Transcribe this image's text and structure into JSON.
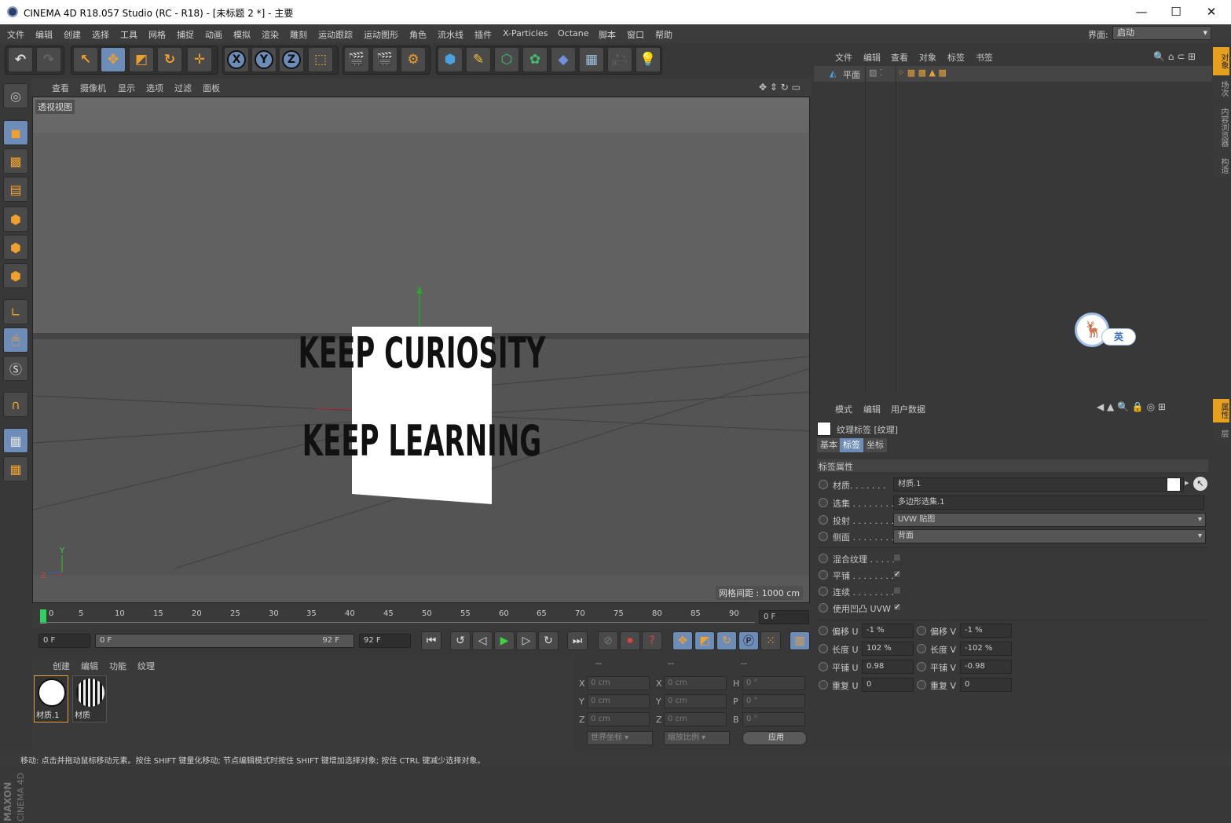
{
  "window": {
    "title": "CINEMA 4D R18.057 Studio (RC - R18) - [未标题 2 *] - 主要",
    "controls": [
      "—",
      "☐",
      "✕"
    ]
  },
  "menubar": {
    "items": [
      "文件",
      "编辑",
      "创建",
      "选择",
      "工具",
      "网格",
      "捕捉",
      "动画",
      "模拟",
      "渲染",
      "雕刻",
      "运动跟踪",
      "运动图形",
      "角色",
      "流水线",
      "插件",
      "X-Particles",
      "Octane",
      "脚本",
      "窗口",
      "帮助"
    ],
    "layout_label": "界面:",
    "layout_value": "启动"
  },
  "toolbar": {
    "axis_x": "X",
    "axis_y": "Y",
    "axis_z": "Z"
  },
  "viewport": {
    "menu": [
      "查看",
      "摄像机",
      "显示",
      "选项",
      "过滤",
      "面板"
    ],
    "label": "透视视图",
    "grid_info": "网格间距 : 1000 cm",
    "texture_line1": "KEEP CURIOSITY",
    "texture_line2": "KEEP LEARNING",
    "axis_y_label": "Y",
    "axis_z_label": "Z"
  },
  "timeline": {
    "ticks": [
      "0",
      "5",
      "10",
      "15",
      "20",
      "25",
      "30",
      "35",
      "40",
      "45",
      "50",
      "55",
      "60",
      "65",
      "70",
      "75",
      "80",
      "85",
      "90"
    ],
    "current_frame": "0 F"
  },
  "playbar": {
    "start": "0 F",
    "range_start": "0 F",
    "range_end": "92 F",
    "end": "92 F"
  },
  "material_manager": {
    "menu": [
      "创建",
      "编辑",
      "功能",
      "纹理"
    ],
    "materials": [
      "材质.1",
      "材质"
    ]
  },
  "coords": {
    "headers": [
      "--",
      "--",
      "--"
    ],
    "rows": [
      {
        "a": "X",
        "av": "0 cm",
        "b": "X",
        "bv": "0 cm",
        "c": "H",
        "cv": "0 °"
      },
      {
        "a": "Y",
        "av": "0 cm",
        "b": "Y",
        "bv": "0 cm",
        "c": "P",
        "cv": "0 °"
      },
      {
        "a": "Z",
        "av": "0 cm",
        "b": "Z",
        "bv": "0 cm",
        "c": "B",
        "cv": "0 °"
      }
    ],
    "world_select": "世界坐标",
    "scale_select": "缩放比例",
    "apply_button": "应用"
  },
  "status": {
    "text": "移动: 点击并拖动鼠标移动元素。按住 SHIFT 键量化移动; 节点编辑模式时按住 SHIFT 键增加选择对象; 按住 CTRL 键减少选择对象。"
  },
  "object_manager": {
    "menu": [
      "文件",
      "编辑",
      "查看",
      "对象",
      "标签",
      "书签"
    ],
    "object_name": "平面"
  },
  "side_tabs": {
    "top": [
      "对象",
      "场次",
      "内容浏览器",
      "构造"
    ],
    "bottom": [
      "属性",
      "层"
    ]
  },
  "attributes": {
    "menu": [
      "模式",
      "编辑",
      "用户数据"
    ],
    "title": "纹理标签 [纹理]",
    "tabs": [
      "基本",
      "标签",
      "坐标"
    ],
    "section": "标签属性",
    "material_label": "材质. . . . . . .",
    "material_value": "材质.1",
    "selection_label": "选集 . . . . . . . .",
    "selection_value": "多边形选集.1",
    "projection_label": "投射 . . . . . . . .",
    "projection_value": "UVW 贴图",
    "side_label": "侧面 . . . . . . . .",
    "side_value": "背面",
    "mix_label": "混合纹理 . . . . .",
    "tile_label": "平铺 . . . . . . . .",
    "seamless_label": "连续 . . . . . . . .",
    "bump_label": "使用凹凸 UVW",
    "offset_u_label": "偏移 U",
    "offset_u": "-1 %",
    "offset_v_label": "偏移 V",
    "offset_v": "-1 %",
    "length_u_label": "长度 U",
    "length_u": "102 %",
    "length_v_label": "长度 V",
    "length_v": "-102 %",
    "tiles_u_label": "平铺 U",
    "tiles_u": "0.98",
    "tiles_v_label": "平铺 V",
    "tiles_v": "-0.98",
    "repeat_u_label": "重复 U",
    "repeat_u": "0",
    "repeat_v_label": "重复 V",
    "repeat_v": "0",
    "check_mark": "✓"
  },
  "ime": {
    "badge": "英"
  }
}
